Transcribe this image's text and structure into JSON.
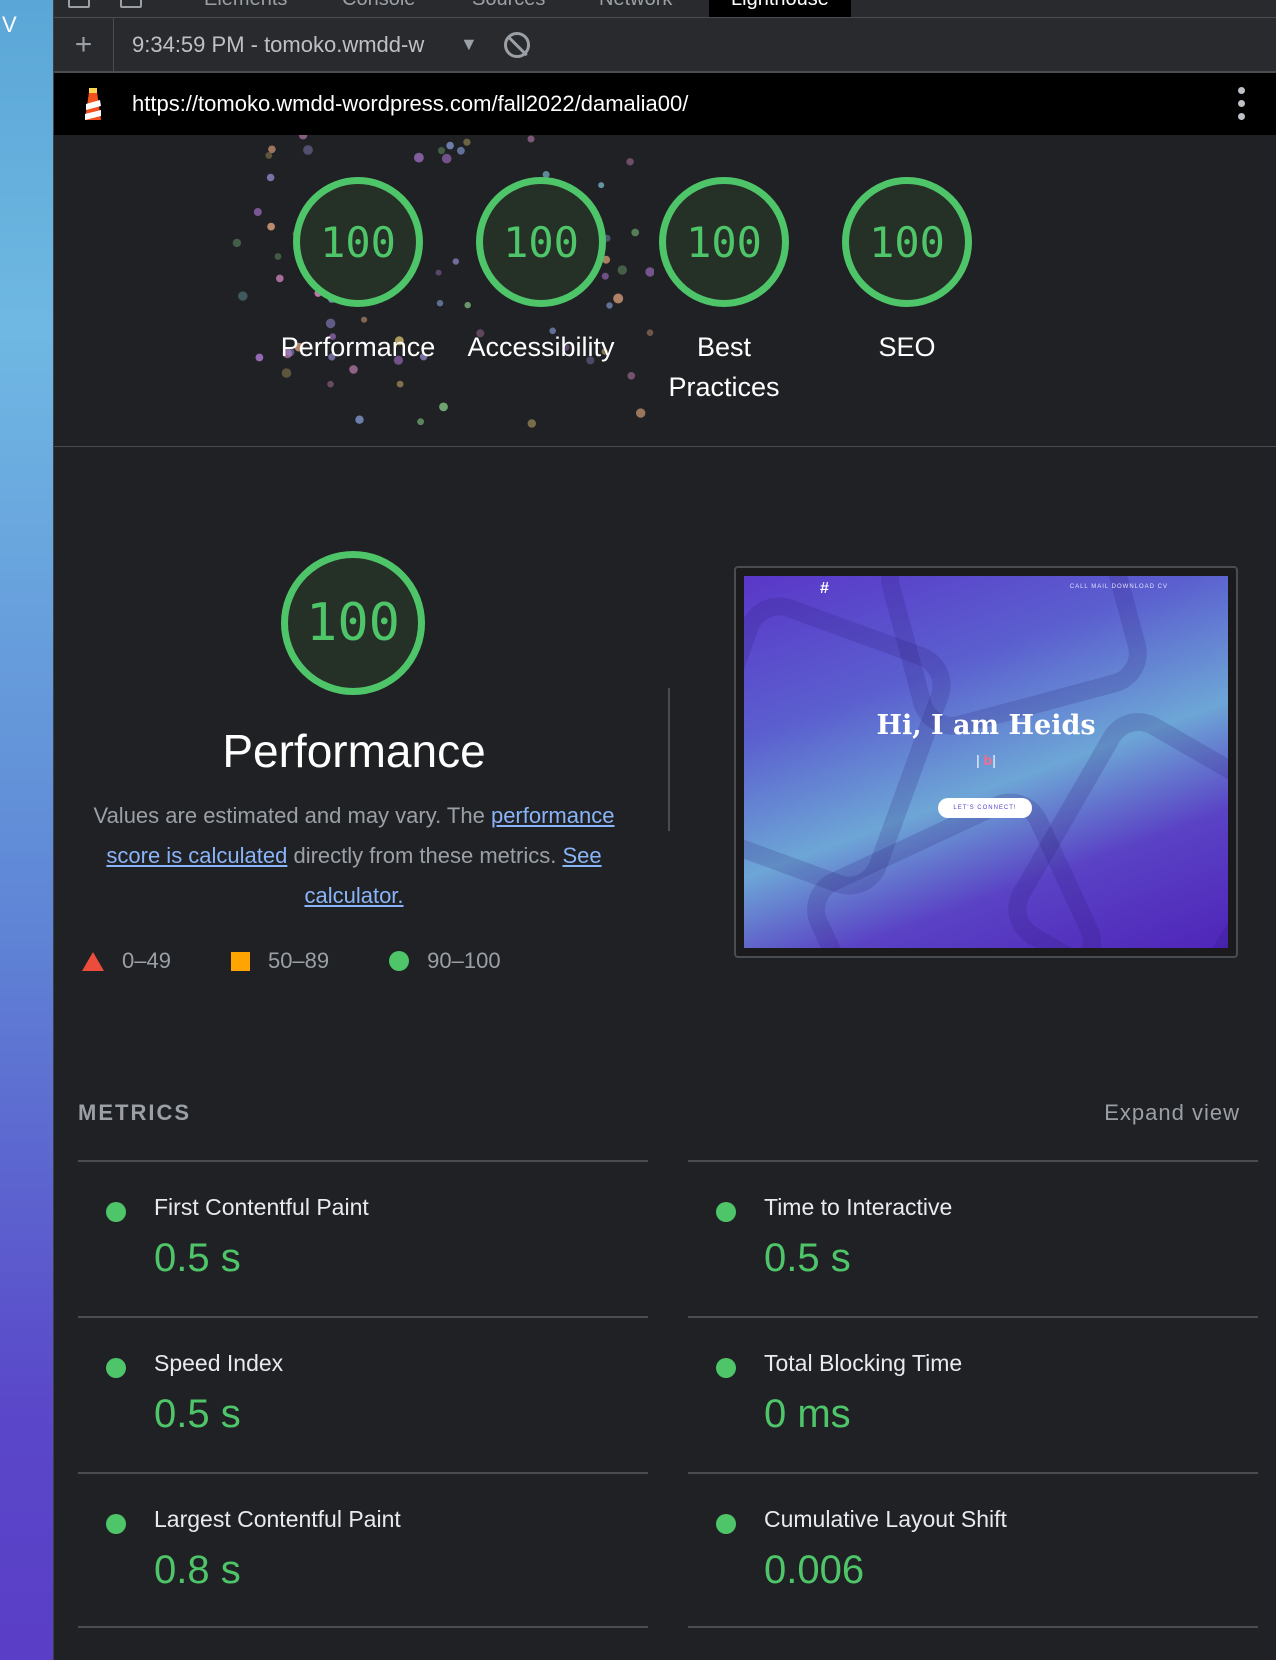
{
  "page_strip": {
    "text": "V"
  },
  "devtools_tabs": [
    "Elements",
    "Console",
    "Sources",
    "Network",
    "Lighthouse"
  ],
  "toolbar": {
    "add_label": "+",
    "report_select": "9:34:59 PM - tomoko.wmdd-w",
    "report_caret": "▼"
  },
  "urlbar": {
    "url": "https://tomoko.wmdd-wordpress.com/fall2022/damalia00/"
  },
  "gauges": [
    {
      "score": "100",
      "label": "Performance"
    },
    {
      "score": "100",
      "label": "Accessibility"
    },
    {
      "score": "100",
      "label": "Best Practices"
    },
    {
      "score": "100",
      "label": "SEO"
    }
  ],
  "performance": {
    "score": "100",
    "title": "Performance",
    "desc_start": "Values are estimated and may vary. The ",
    "desc_link1": "performance score is calculated",
    "desc_mid": " directly from these metrics. ",
    "desc_link2": "See calculator."
  },
  "legend": [
    {
      "shape": "triangle",
      "range": "0–49",
      "color": "#eb4c3c"
    },
    {
      "shape": "square",
      "range": "50–89",
      "color": "#ffa400"
    },
    {
      "shape": "circle",
      "range": "90–100",
      "color": "#4fc569"
    }
  ],
  "screenshot": {
    "logo": "#",
    "nav": "CALL   MAIL   DOWNLOAD CV",
    "hero": "Hi, I am Heids",
    "cursor_before": "| ",
    "cursor_char": "b",
    "cursor_after": "|",
    "button": "LET'S CONNECT!"
  },
  "metrics": {
    "heading": "METRICS",
    "expand_label": "Expand view",
    "items": [
      {
        "label": "First Contentful Paint",
        "value": "0.5 s"
      },
      {
        "label": "Time to Interactive",
        "value": "0.5 s"
      },
      {
        "label": "Speed Index",
        "value": "0.5 s"
      },
      {
        "label": "Total Blocking Time",
        "value": "0 ms"
      },
      {
        "label": "Largest Contentful Paint",
        "value": "0.8 s"
      },
      {
        "label": "Cumulative Layout Shift",
        "value": "0.006"
      }
    ]
  },
  "colors": {
    "pass": "#4fc569",
    "average": "#ffa400",
    "fail": "#eb4c3c",
    "link": "#8ab4f8"
  }
}
